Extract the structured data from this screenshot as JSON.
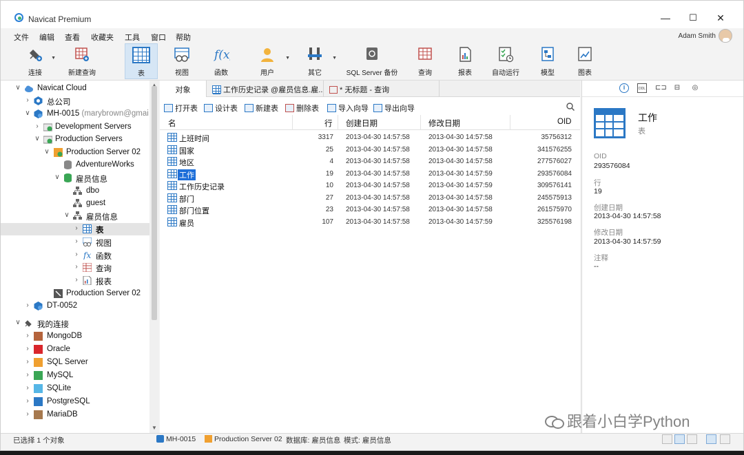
{
  "window": {
    "title": "Navicat Premium",
    "minimize": "—",
    "maximize": "☐",
    "close": "✕"
  },
  "menu": [
    "文件",
    "编辑",
    "查看",
    "收藏夹",
    "工具",
    "窗口",
    "帮助"
  ],
  "user": {
    "name": "Adam Smith"
  },
  "toolbar": [
    {
      "label": "连接",
      "icon": "plug-icon",
      "dropdown": true
    },
    {
      "label": "新建查询",
      "icon": "new-query-icon",
      "dropdown": false
    },
    {
      "label": "表",
      "icon": "table-icon",
      "dropdown": false,
      "active": true
    },
    {
      "label": "视图",
      "icon": "view-icon",
      "dropdown": false
    },
    {
      "label": "函数",
      "icon": "function-icon",
      "dropdown": false
    },
    {
      "label": "用户",
      "icon": "user-icon",
      "dropdown": true
    },
    {
      "label": "其它",
      "icon": "tools-icon",
      "dropdown": true
    },
    {
      "label": "SQL Server 备份",
      "icon": "backup-icon",
      "dropdown": false
    },
    {
      "label": "查询",
      "icon": "query-icon",
      "dropdown": false
    },
    {
      "label": "报表",
      "icon": "report-icon",
      "dropdown": false
    },
    {
      "label": "自动运行",
      "icon": "automation-icon",
      "dropdown": false
    },
    {
      "label": "模型",
      "icon": "model-icon",
      "dropdown": false
    },
    {
      "label": "图表",
      "icon": "chart-icon",
      "dropdown": false
    }
  ],
  "tree": [
    {
      "label": "Navicat Cloud",
      "arrow": "∨",
      "icon": "cloud-icon"
    },
    {
      "label": "总公司",
      "arrow": "›",
      "icon": "project-icon"
    },
    {
      "label": "MH-0015",
      "sub": " (marybrown@gmai",
      "arrow": "∨",
      "icon": "cloud-project-icon"
    },
    {
      "label": "Development Servers",
      "arrow": "›",
      "icon": "server-group-icon"
    },
    {
      "label": "Production Servers",
      "arrow": "∨",
      "icon": "server-group-icon"
    },
    {
      "label": "Production Server 02",
      "arrow": "∨",
      "icon": "sqlserver-icon"
    },
    {
      "label": "AdventureWorks",
      "arrow": "",
      "icon": "database-icon"
    },
    {
      "label": "雇员信息",
      "arrow": "∨",
      "icon": "database-icon"
    },
    {
      "label": "dbo",
      "arrow": "",
      "icon": "schema-icon"
    },
    {
      "label": "guest",
      "arrow": "",
      "icon": "schema-icon"
    },
    {
      "label": "雇员信息",
      "arrow": "∨",
      "icon": "schema-icon"
    },
    {
      "label": "表",
      "arrow": "›",
      "icon": "table-icon",
      "selected": true
    },
    {
      "label": "视图",
      "arrow": "›",
      "icon": "view-icon"
    },
    {
      "label": "函数",
      "arrow": "›",
      "icon": "function-icon"
    },
    {
      "label": "查询",
      "arrow": "›",
      "icon": "query-icon"
    },
    {
      "label": "报表",
      "arrow": "›",
      "icon": "report-icon"
    },
    {
      "label": "Production Server 02",
      "arrow": "",
      "icon": "server-icon"
    },
    {
      "label": "DT-0052",
      "arrow": "›",
      "icon": "cloud-project-icon"
    },
    {
      "label": "我的连接",
      "arrow": "∨",
      "icon": "connection-icon"
    },
    {
      "label": "MongoDB",
      "arrow": "›",
      "icon": "mongodb-icon"
    },
    {
      "label": "Oracle",
      "arrow": "›",
      "icon": "oracle-icon"
    },
    {
      "label": "SQL Server",
      "arrow": "›",
      "icon": "sqlserver-icon"
    },
    {
      "label": "MySQL",
      "arrow": "›",
      "icon": "mysql-icon"
    },
    {
      "label": "SQLite",
      "arrow": "›",
      "icon": "sqlite-icon"
    },
    {
      "label": "PostgreSQL",
      "arrow": "›",
      "icon": "postgresql-icon"
    },
    {
      "label": "MariaDB",
      "arrow": "›",
      "icon": "mariadb-icon"
    }
  ],
  "tabs": [
    {
      "label": "对象",
      "active": true
    },
    {
      "label": "工作历史记录 @雇员信息.雇...",
      "active": false
    },
    {
      "label": "* 无标题 - 查询",
      "active": false
    }
  ],
  "actions": [
    "打开表",
    "设计表",
    "新建表",
    "删除表",
    "导入向导",
    "导出向导"
  ],
  "columns": [
    "名",
    "行",
    "创建日期",
    "修改日期",
    "OID"
  ],
  "rows": [
    {
      "name": "上班时间",
      "rows": "3317",
      "created": "2013-04-30 14:57:58",
      "modified": "2013-04-30 14:57:58",
      "oid": "35756312"
    },
    {
      "name": "国家",
      "rows": "25",
      "created": "2013-04-30 14:57:58",
      "modified": "2013-04-30 14:57:58",
      "oid": "341576255"
    },
    {
      "name": "地区",
      "rows": "4",
      "created": "2013-04-30 14:57:58",
      "modified": "2013-04-30 14:57:58",
      "oid": "277576027"
    },
    {
      "name": "工作",
      "rows": "19",
      "created": "2013-04-30 14:57:58",
      "modified": "2013-04-30 14:57:59",
      "oid": "293576084",
      "selected": true
    },
    {
      "name": "工作历史记录",
      "rows": "10",
      "created": "2013-04-30 14:57:58",
      "modified": "2013-04-30 14:57:59",
      "oid": "309576141"
    },
    {
      "name": "部门",
      "rows": "27",
      "created": "2013-04-30 14:57:58",
      "modified": "2013-04-30 14:57:58",
      "oid": "245575913"
    },
    {
      "name": "部门位置",
      "rows": "23",
      "created": "2013-04-30 14:57:58",
      "modified": "2013-04-30 14:57:58",
      "oid": "261575970"
    },
    {
      "name": "雇员",
      "rows": "107",
      "created": "2013-04-30 14:57:58",
      "modified": "2013-04-30 14:57:59",
      "oid": "325576198"
    }
  ],
  "details": {
    "name": "工作",
    "type": "表",
    "props": [
      {
        "label": "OID",
        "value": "293576084"
      },
      {
        "label": "行",
        "value": "19"
      },
      {
        "label": "创建日期",
        "value": "2013-04-30 14:57:58"
      },
      {
        "label": "修改日期",
        "value": "2013-04-30 14:57:59"
      },
      {
        "label": "注释",
        "value": "--"
      }
    ]
  },
  "status": {
    "selection": "已选择 1 个对象",
    "project": "MH-0015",
    "server": "Production Server 02",
    "database": "数据库: 雇员信息",
    "schema": "模式: 雇员信息"
  },
  "watermark": "跟着小白学Python",
  "colors": {
    "accent": "#2b78c5",
    "selection": "#1e6fd9"
  }
}
